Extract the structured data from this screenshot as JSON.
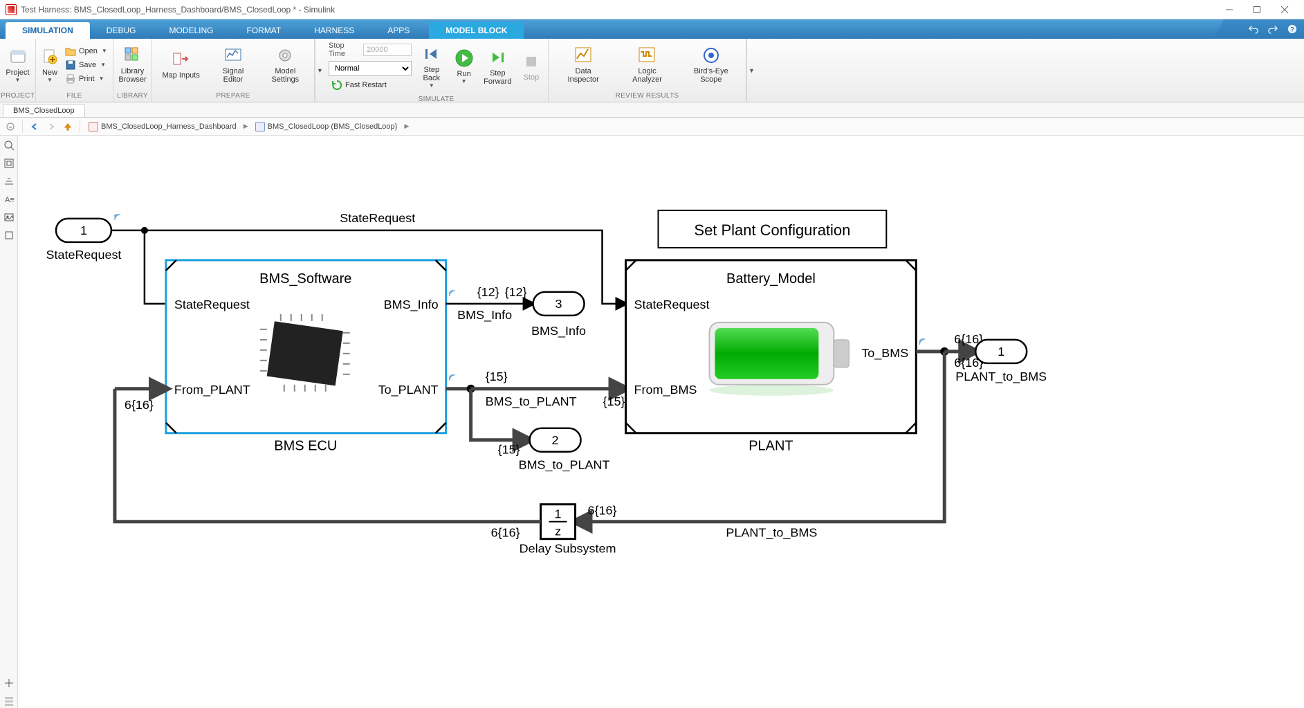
{
  "window": {
    "title": "Test Harness: BMS_ClosedLoop_Harness_Dashboard/BMS_ClosedLoop * - Simulink"
  },
  "tabs": {
    "simulation": "SIMULATION",
    "debug": "DEBUG",
    "modeling": "MODELING",
    "format": "FORMAT",
    "harness": "HARNESS",
    "apps": "APPS",
    "model_block": "MODEL BLOCK"
  },
  "ribbon": {
    "project": {
      "label": "PROJECT",
      "new_project": "Project"
    },
    "file": {
      "label": "FILE",
      "new": "New",
      "open": "Open",
      "save": "Save",
      "print": "Print"
    },
    "library": {
      "label": "LIBRARY",
      "browser": "Library Browser"
    },
    "prepare": {
      "label": "PREPARE",
      "map_inputs": "Map Inputs",
      "signal_editor": "Signal Editor",
      "model_settings": "Model Settings"
    },
    "simulate": {
      "label": "SIMULATE",
      "stop_time_label": "Stop Time",
      "stop_time_value": "20000",
      "mode": "Normal",
      "fast_restart": "Fast Restart",
      "step_back": "Step Back",
      "run": "Run",
      "step_forward": "Step Forward",
      "stop": "Stop"
    },
    "review": {
      "label": "REVIEW RESULTS",
      "data_inspector": "Data Inspector",
      "logic_analyzer": "Logic Analyzer",
      "birdseye": "Bird's-Eye Scope"
    }
  },
  "doctab": "BMS_ClosedLoop",
  "breadcrumb": {
    "item1": "BMS_ClosedLoop_Harness_Dashboard",
    "item2": "BMS_ClosedLoop (BMS_ClosedLoop)"
  },
  "diagram": {
    "inport1": {
      "num": "1",
      "label": "StateRequest"
    },
    "sig_state_request": "StateRequest",
    "annot_left": "6{16}",
    "bms_block": {
      "title": "BMS_Software",
      "in1": "StateRequest",
      "in2": "From_PLANT",
      "out1": "BMS_Info",
      "out2": "To_PLANT",
      "caption": "BMS ECU"
    },
    "bms_info_sig": "BMS_Info",
    "bms_info_dim1": "{12}",
    "bms_info_dim2": "{12}",
    "outport3": {
      "num": "3",
      "label": "BMS_Info"
    },
    "to_plant_sig": "BMS_to_PLANT",
    "to_plant_dim1": "{15}",
    "to_plant_dim2": "{15}",
    "to_plant_dim3": "{15}",
    "outport2": {
      "num": "2",
      "label": "BMS_to_PLANT"
    },
    "config_box": "Set Plant Configuration",
    "plant_block": {
      "title": "Battery_Model",
      "in1": "StateRequest",
      "in2": "From_BMS",
      "out1": "To_BMS",
      "caption": "PLANT"
    },
    "to_bms_dim1": "6{16}",
    "to_bms_dim2": "6{16}",
    "outport1": {
      "num": "1",
      "label": "PLANT_to_BMS"
    },
    "feedback_sig": "PLANT_to_BMS",
    "feedback_dim": "6{16}",
    "delay": {
      "num": "1",
      "den": "z",
      "caption": "Delay Subsystem",
      "in_dim": "6{16}"
    }
  }
}
